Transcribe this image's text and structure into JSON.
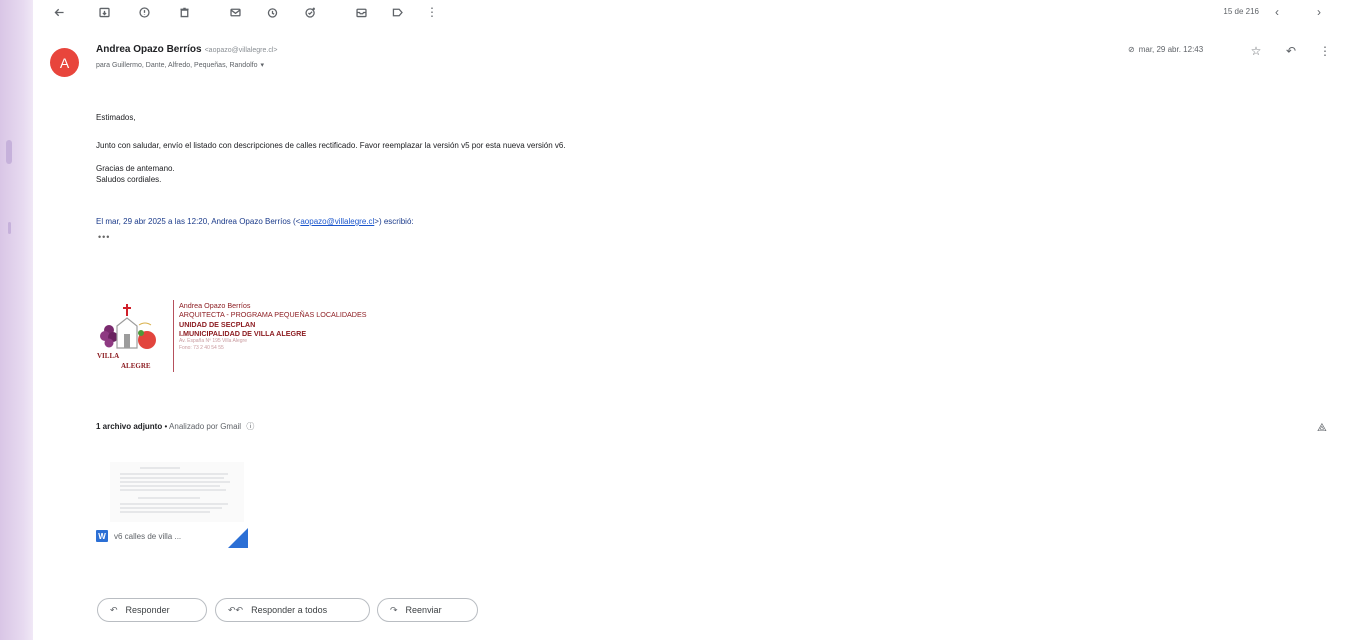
{
  "toolbar": {
    "back_icon": "arrow-left-icon",
    "icons": [
      "archive-icon",
      "report-spam-icon",
      "delete-icon",
      "mark-unread-icon",
      "snooze-icon",
      "add-task-icon",
      "move-to-icon",
      "label-icon",
      "more-vert-icon"
    ],
    "pagination": "15 de 216"
  },
  "header": {
    "avatar_letter": "A",
    "avatar_color": "#e8453c",
    "sender_name": "Andrea Opazo Berríos",
    "sender_email": "<aopazo@villalegre.cl>",
    "recipients": "para Guillermo, Dante, Alfredo, Pequeñas, Randolfo",
    "date": "mar, 29 abr. 12:43"
  },
  "body": {
    "greeting": "Estimados,",
    "paragraph": "Junto con saludar, envío el listado con descripciones de calles rectificado. Favor reemplazar la versión v5 por esta nueva versión v6.",
    "thanks": "Gracias de antemano.",
    "closing": "Saludos cordiales.",
    "quote_prefix": "El mar, 29 abr 2025 a las 12:20, Andrea Opazo Berríos (<",
    "quote_email": "aopazo@villalegre.cl",
    "quote_suffix": ">) escribió:",
    "ellipsis": "•••"
  },
  "signature": {
    "logo_text_1": "VILLA",
    "logo_text_2": "ALEGRE",
    "name": "Andrea Opazo Berríos",
    "role": "ARQUITECTA - PROGRAMA PEQUEÑAS LOCALIDADES",
    "unit": "UNIDAD DE SECPLAN",
    "org": "I.MUNICIPALIDAD DE VILLA ALEGRE",
    "address": "Av. España Nº 195 Villa Alegre",
    "phone": "Fono: 73 2 40 54 55",
    "color": "#8b1a1f"
  },
  "attachments": {
    "count_label": "1 archivo adjunto",
    "scanned_label": "Analizado por Gmail",
    "file_icon_letter": "W",
    "file_name": "v6 calles de villa ..."
  },
  "actions": {
    "reply": "Responder",
    "reply_all": "Responder a todos",
    "forward": "Reenviar"
  }
}
